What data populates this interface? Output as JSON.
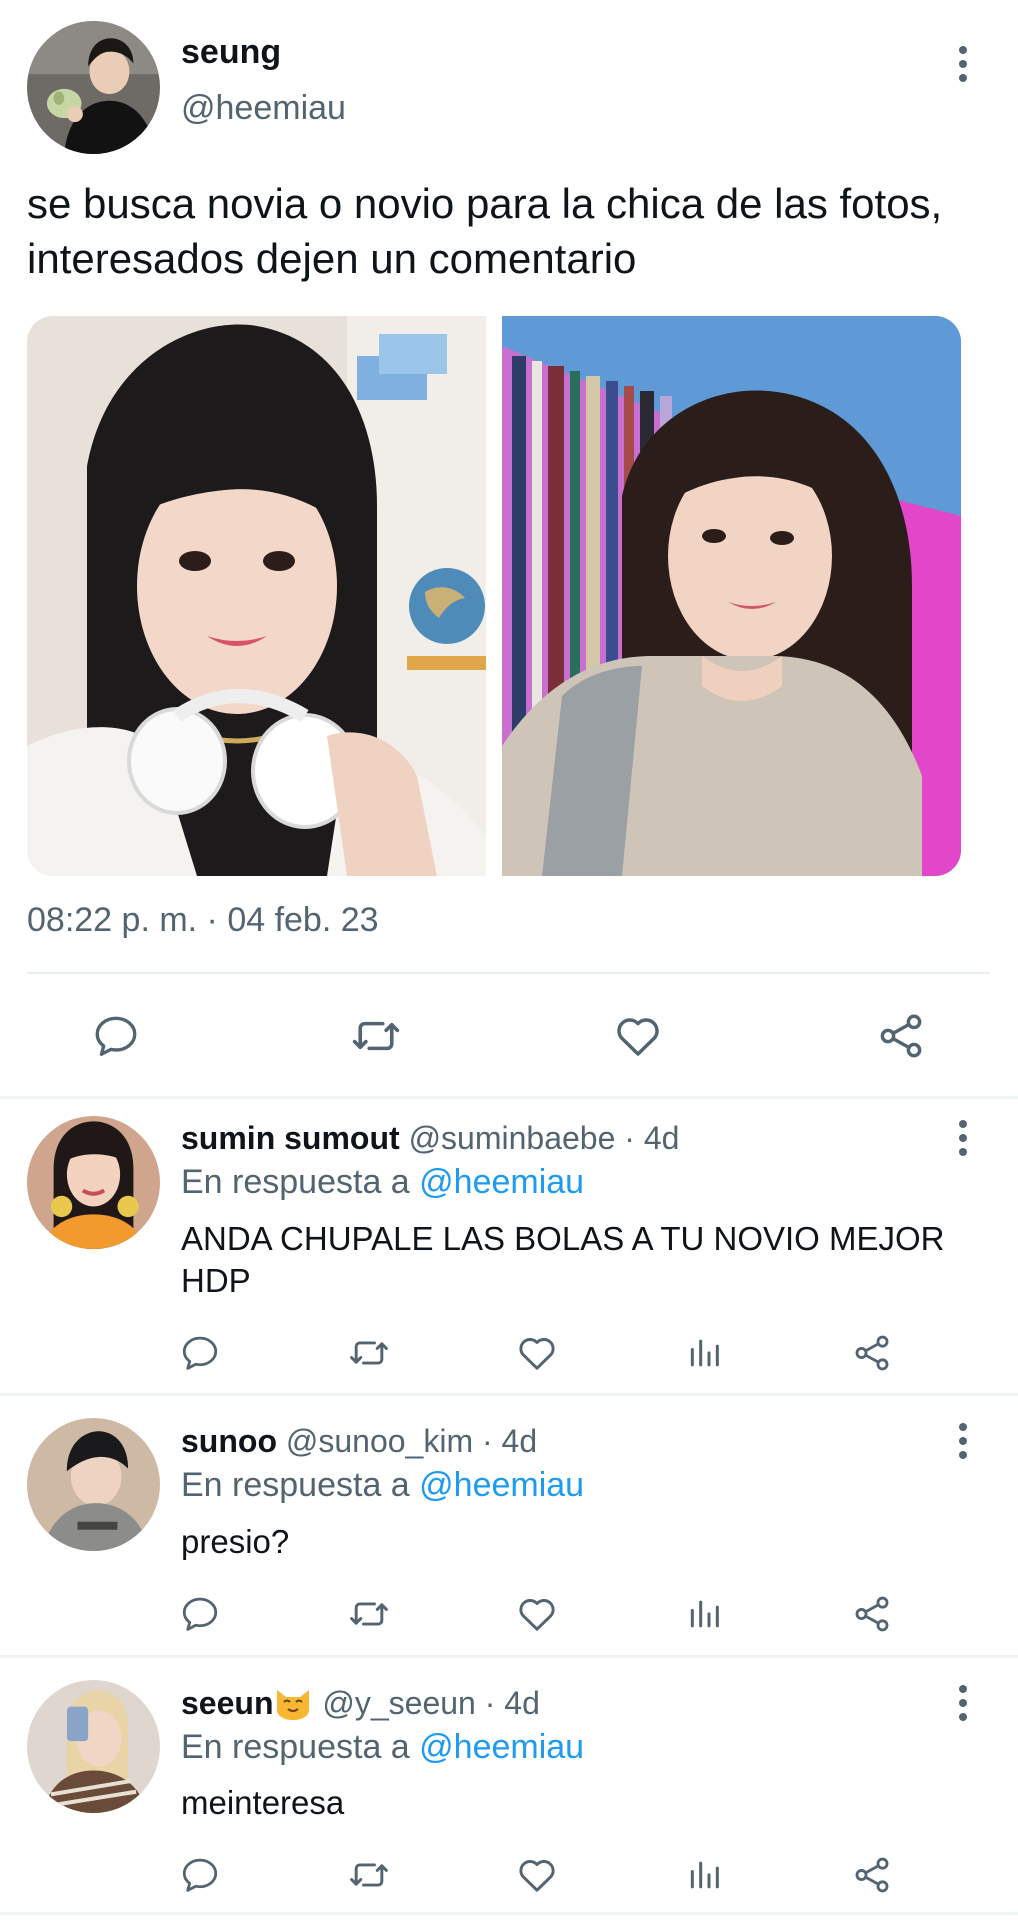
{
  "tweet": {
    "author_name": "seung",
    "author_handle": "@heemiau",
    "text": "se busca novia o novio para la chica de las fotos, interesados dejen un comentario",
    "timestamp": "08:22 p. m. · 04 feb. 23",
    "actions": [
      "reply-icon",
      "retweet-icon",
      "like-icon",
      "share-icon"
    ]
  },
  "replies": [
    {
      "name": "sumin sumout",
      "handle": "@suminbaebe",
      "time": "4d",
      "reply_prefix": "En respuesta a",
      "reply_mention": "@heemiau",
      "text": "ANDA CHUPALE LAS BOLAS A TU NOVIO MEJOR HDP",
      "actions": [
        "reply-icon",
        "retweet-icon",
        "like-icon",
        "stats-icon",
        "share-icon"
      ]
    },
    {
      "name": "sunoo",
      "handle": "@sunoo_kim",
      "time": "4d",
      "reply_prefix": "En respuesta a",
      "reply_mention": "@heemiau",
      "text": "presio?",
      "actions": [
        "reply-icon",
        "retweet-icon",
        "like-icon",
        "stats-icon",
        "share-icon"
      ]
    },
    {
      "name": "seeun",
      "name_emoji": "cat-emoji",
      "handle": "@y_seeun",
      "time": "4d",
      "reply_prefix": "En respuesta a",
      "reply_mention": "@heemiau",
      "text": "meinteresa",
      "actions": [
        "reply-icon",
        "retweet-icon",
        "like-icon",
        "stats-icon",
        "share-icon"
      ]
    }
  ],
  "colors": {
    "text": "#0f1419",
    "secondary": "#536471",
    "mention": "#1d9bf0",
    "divider": "#e6ecf0"
  }
}
